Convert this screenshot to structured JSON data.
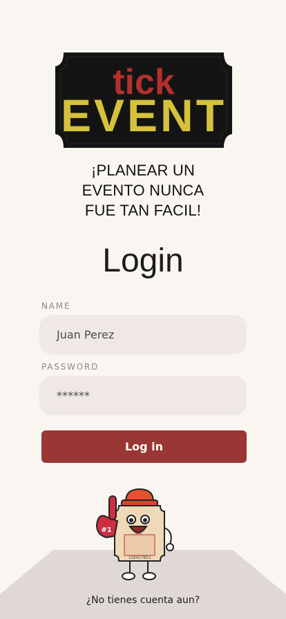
{
  "logo": {
    "top_text": "tick",
    "main_text": "EVENT"
  },
  "tagline": [
    "¡PLANEAR UN",
    "EVENTO NUNCA",
    "FUE TAN FACIL!"
  ],
  "title": "Login",
  "form": {
    "name_label": "NAME",
    "name_value": "Juan Perez",
    "password_label": "PASSWORD",
    "password_value": "******",
    "submit_label": "Log in"
  },
  "mascot": {
    "badge": "#1",
    "ticket_number": "150427853"
  },
  "signup_link": "¿No tienes cuenta aun?",
  "colors": {
    "background": "#f9f6f2",
    "accent": "#993734",
    "field_bg": "#efe8e4",
    "logo_gold": "#d6c23a",
    "logo_red": "#b3302c"
  }
}
